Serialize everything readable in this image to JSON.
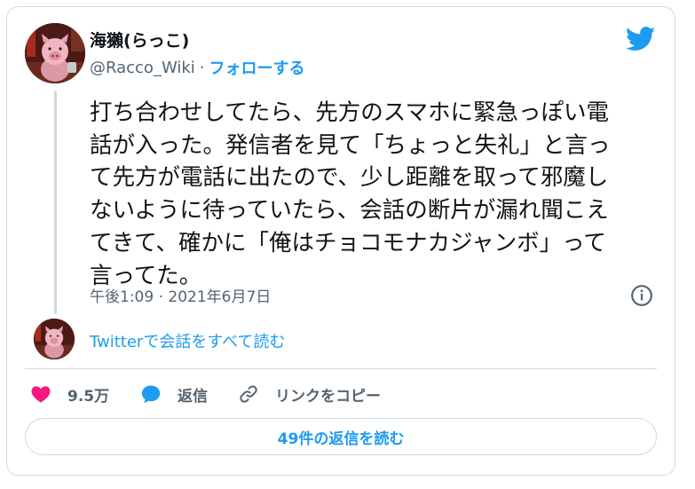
{
  "author": {
    "display_name": "海獺(らっこ)",
    "handle": "@Racco_Wiki",
    "separator": "·",
    "follow_label": "フォローする"
  },
  "tweet": {
    "text": "打ち合わせしてたら、先方のスマホに緊急っぽい電\n話が入った。発信者を見て「ちょっと失礼」と言っ\nて先方が電話に出たので、少し距離を取って邪魔し\nないように待っていたら、会話の断片が漏れ聞こえ\nてきて、確かに「俺はチョコモナカジャンボ」って\n言ってた。",
    "timestamp": "午後1:09 · 2021年6月7日"
  },
  "thread": {
    "read_conversation_label": "Twitterで会話をすべて読む"
  },
  "actions": {
    "like_count": "9.5万",
    "reply_label": "返信",
    "copy_link_label": "リンクをコピー"
  },
  "replies_button_label": "49件の返信を読む",
  "icons": [
    "twitter-bird",
    "info",
    "heart",
    "speech-bubble",
    "link"
  ],
  "colors": {
    "accent": "#1d9bf0",
    "like": "#f91880",
    "muted": "#536471",
    "border": "#cfd9de"
  }
}
